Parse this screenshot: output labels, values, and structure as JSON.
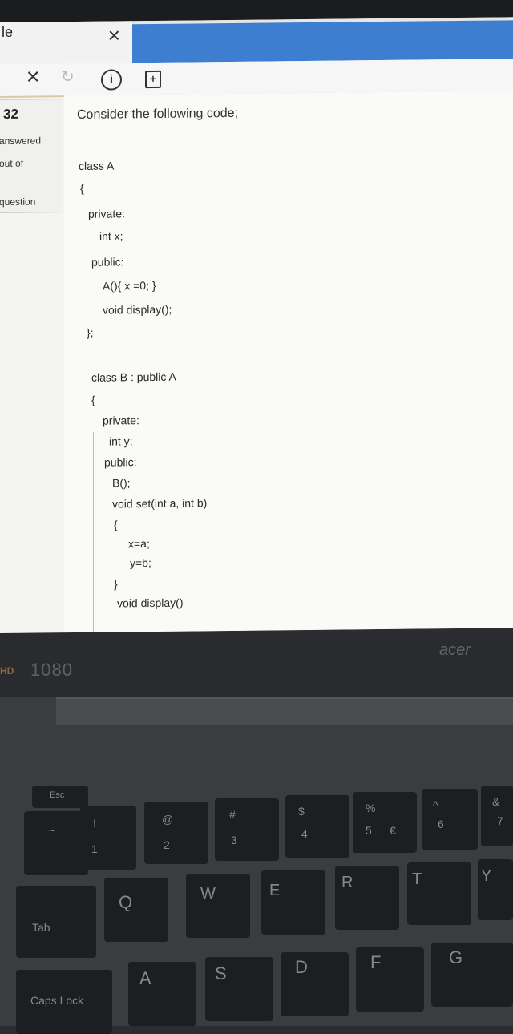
{
  "browser": {
    "tab_title": "le",
    "tab_close": "✕",
    "stop_icon": "✕",
    "reload_icon": "↻",
    "info_icon": "ⓘ",
    "new_tab_icon": "+"
  },
  "question_info": {
    "number": "32",
    "status": "answered",
    "out_of": "out of",
    "question": "question"
  },
  "question": {
    "prompt": "Consider the following code;",
    "code": [
      "class A",
      "{",
      "private:",
      "int x;",
      "public:",
      "A(){ x =0; }",
      "void display();",
      "};",
      "class B : public A",
      "{",
      "private:",
      "int y;",
      "public:",
      "B();",
      "void set(int a, int b)",
      "{",
      "x=a;",
      "y=b;",
      "}",
      "void display()"
    ]
  },
  "laptop": {
    "logo": "acer",
    "full_hd": "HD",
    "resolution": "1080",
    "keys": {
      "esc": "Esc",
      "tab": "Tab",
      "caps": "Caps Lock",
      "q": "Q",
      "w": "W",
      "e": "E",
      "r": "R",
      "t": "T",
      "y": "Y",
      "a": "A",
      "s": "S",
      "d": "D",
      "f": "F",
      "g": "G",
      "n1": "1",
      "n2": "2",
      "n3": "3",
      "n4": "4",
      "n5": "5",
      "n6": "6",
      "n7": "7",
      "s1": "!",
      "s2": "@",
      "s3": "#",
      "s4": "$",
      "s5": "%",
      "s6": "^",
      "s7": "&",
      "euro": "€",
      "tilde": "~"
    }
  }
}
